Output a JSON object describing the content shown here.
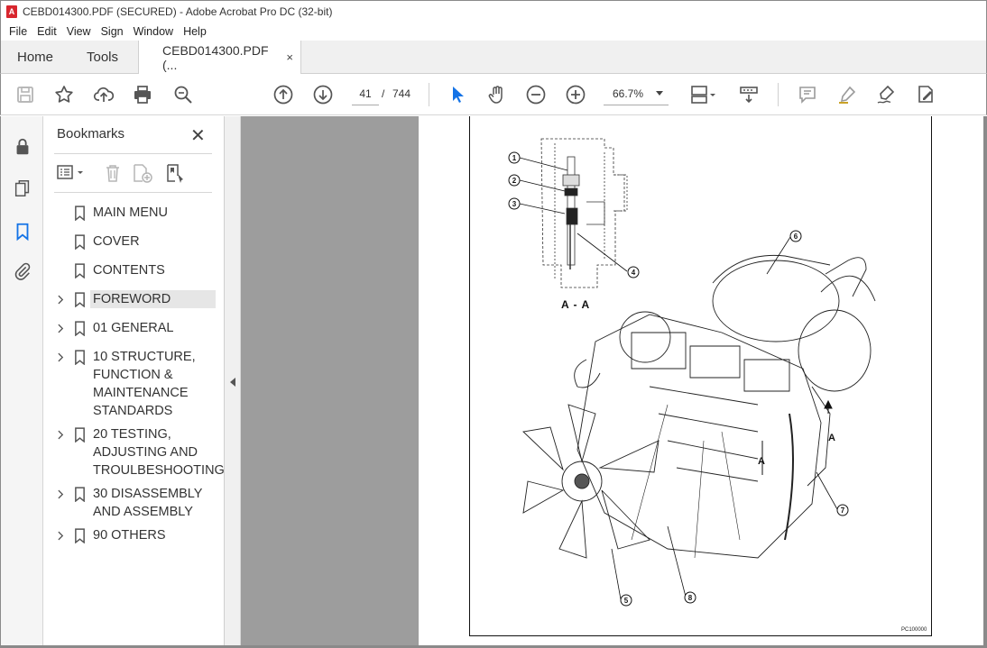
{
  "window": {
    "title": "CEBD014300.PDF (SECURED) - Adobe Acrobat Pro DC (32-bit)",
    "app_icon": "A"
  },
  "menu": [
    "File",
    "Edit",
    "View",
    "Sign",
    "Window",
    "Help"
  ],
  "tabs": {
    "home": "Home",
    "tools": "Tools",
    "doc": "CEBD014300.PDF (...",
    "close": "×"
  },
  "toolbar": {
    "page_current": "41",
    "page_sep": "/",
    "page_total": "744",
    "zoom": "66.7%"
  },
  "bookmarks": {
    "title": "Bookmarks",
    "close": "✕",
    "items": [
      {
        "label": "MAIN MENU",
        "expandable": false
      },
      {
        "label": "COVER",
        "expandable": false
      },
      {
        "label": "CONTENTS",
        "expandable": false
      },
      {
        "label": "FOREWORD",
        "expandable": true,
        "selected": true
      },
      {
        "label": "01 GENERAL",
        "expandable": true
      },
      {
        "label": "10 STRUCTURE, FUNCTION & MAINTENANCE STANDARDS",
        "expandable": true
      },
      {
        "label": "20 TESTING, ADJUSTING AND TROULBESHOOTING",
        "expandable": true
      },
      {
        "label": "30 DISASSEMBLY AND ASSEMBLY",
        "expandable": true
      },
      {
        "label": "90 OTHERS",
        "expandable": true
      }
    ]
  },
  "document": {
    "section_label": "A - A",
    "callouts": [
      "1",
      "2",
      "3",
      "4",
      "5",
      "6",
      "7",
      "8"
    ],
    "arrow_label": "A",
    "figure_code": "PC100000"
  },
  "colors": {
    "accent_blue": "#1473e6",
    "acrobat_red": "#d8262e",
    "viewer_gray": "#9d9d9d"
  }
}
